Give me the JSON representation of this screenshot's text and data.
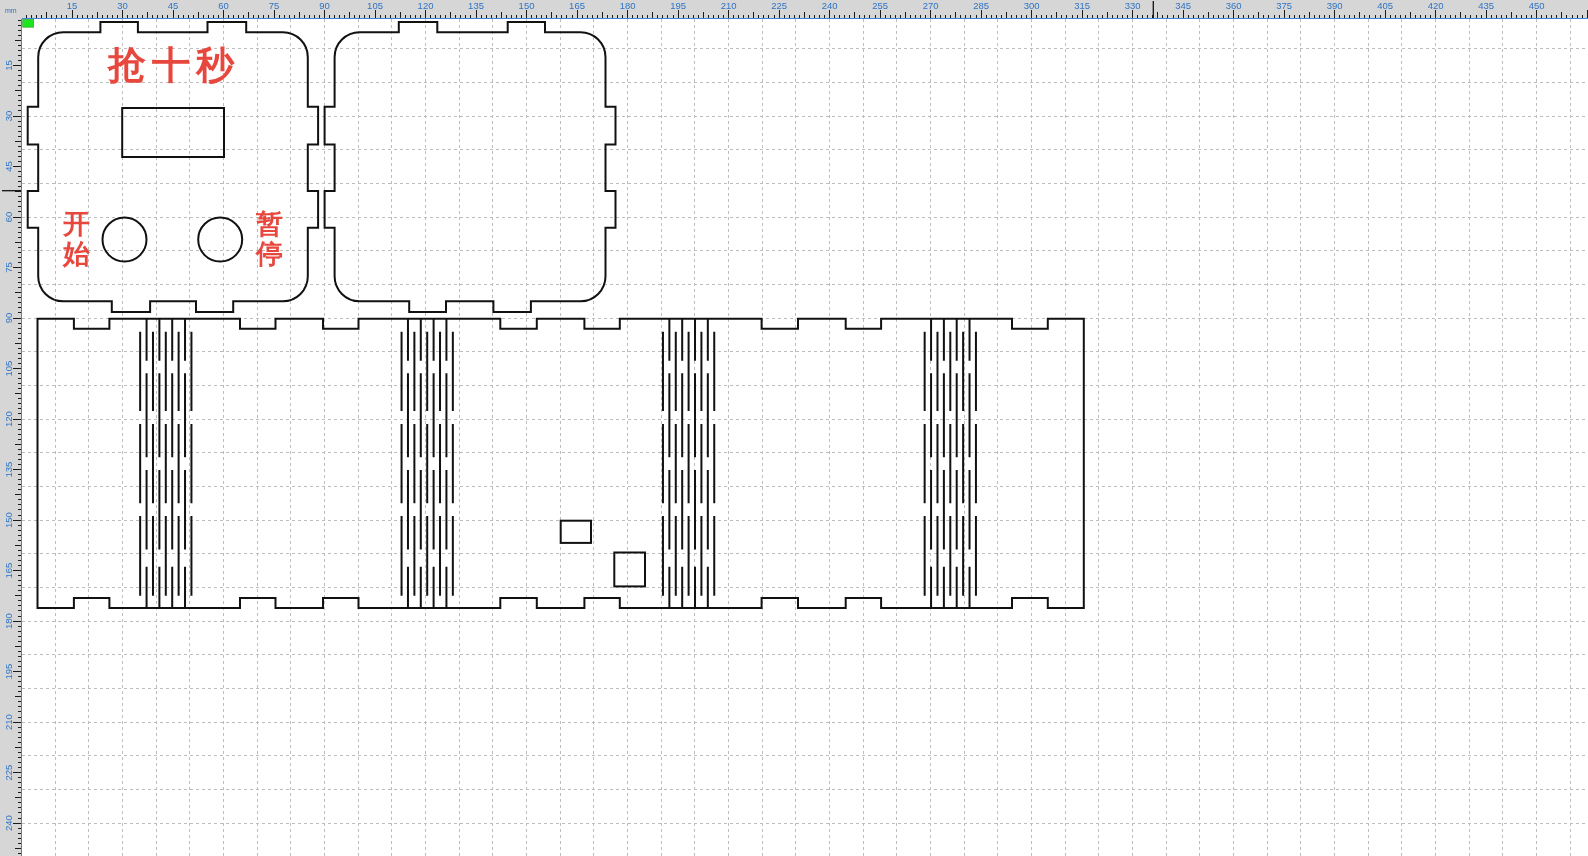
{
  "ruler": {
    "unit": "mm",
    "top_labels": [
      "15",
      "30",
      "45",
      "60",
      "75",
      "90",
      "105",
      "120",
      "135",
      "150",
      "165",
      "180",
      "195",
      "210",
      "225",
      "240",
      "255",
      "270",
      "285",
      "300",
      "315",
      "330",
      "345",
      "360",
      "375",
      "390",
      "405",
      "420",
      "435",
      "450"
    ],
    "left_labels": [
      "15",
      "30",
      "45",
      "60",
      "75",
      "90",
      "105",
      "120",
      "135",
      "150",
      "165",
      "180",
      "195",
      "210",
      "225",
      "240"
    ]
  },
  "front_panel": {
    "title": "抢十秒",
    "left_label": "开始",
    "right_label": "暂停"
  }
}
